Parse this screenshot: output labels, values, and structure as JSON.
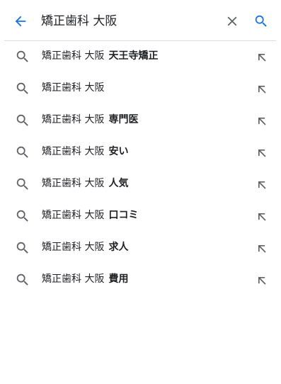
{
  "colors": {
    "accent": "#1a73e8",
    "icon_gray": "#5f6368",
    "text": "#202124",
    "divider": "#dadce0"
  },
  "search": {
    "query": "矯正歯科 大阪",
    "back_icon": "arrow-left-icon",
    "clear_icon": "close-icon",
    "search_icon": "search-icon"
  },
  "suggestions": [
    {
      "base": "矯正歯科 大阪",
      "completion": "天王寺矯正",
      "icon": "search-icon",
      "fill_icon": "arrow-up-left-icon"
    },
    {
      "base": "矯正歯科 大阪",
      "completion": "",
      "icon": "search-icon",
      "fill_icon": "arrow-up-left-icon"
    },
    {
      "base": "矯正歯科 大阪",
      "completion": "専門医",
      "icon": "search-icon",
      "fill_icon": "arrow-up-left-icon"
    },
    {
      "base": "矯正歯科 大阪",
      "completion": "安い",
      "icon": "search-icon",
      "fill_icon": "arrow-up-left-icon"
    },
    {
      "base": "矯正歯科 大阪",
      "completion": "人気",
      "icon": "search-icon",
      "fill_icon": "arrow-up-left-icon"
    },
    {
      "base": "矯正歯科 大阪",
      "completion": "口コミ",
      "icon": "search-icon",
      "fill_icon": "arrow-up-left-icon"
    },
    {
      "base": "矯正歯科 大阪",
      "completion": "求人",
      "icon": "search-icon",
      "fill_icon": "arrow-up-left-icon"
    },
    {
      "base": "矯正歯科 大阪",
      "completion": "費用",
      "icon": "search-icon",
      "fill_icon": "arrow-up-left-icon"
    }
  ]
}
